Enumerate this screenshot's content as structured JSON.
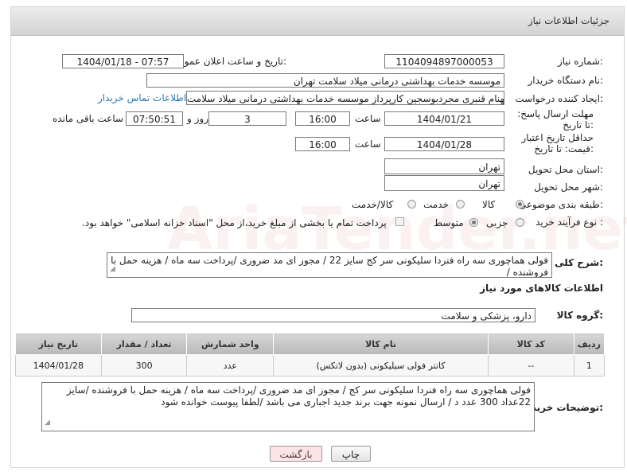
{
  "header": {
    "title": "جزئیات اطلاعات نیاز"
  },
  "fields": {
    "need_number_label": "شماره نیاز:",
    "need_number": "1104094897000053",
    "announce_label": "تاریخ و ساعت اعلان عمومی:",
    "announce_value": "1404/01/18 - 07:57",
    "buyer_org_label": "نام دستگاه خریدار:",
    "buyer_org": "موسسه خدمات بهداشتی درمانی میلاد سلامت تهران",
    "creator_label": "ایجاد کننده درخواست:",
    "creator": "بهنام قنبری مجردبوسجین کارپرداز موسسه خدمات بهداشتی درمانی میلاد سلامت",
    "contact_link": "اطلاعات تماس خریدار",
    "deadline_label": "مهلت ارسال پاسخ: تا تاریخ:",
    "deadline_date": "1404/01/21",
    "time_label": "ساعت",
    "deadline_time": "16:00",
    "days_value": "3",
    "days_label": "روز و",
    "remaining_time": "07:50:51",
    "remaining_label": "ساعت باقی مانده",
    "price_validity_label": "حداقل تاریخ اعتبار قیمت: تا تاریخ:",
    "price_validity_date": "1404/01/28",
    "price_validity_time": "16:00",
    "province_label": "استان محل تحویل:",
    "province": "تهران",
    "city_label": "شهر محل تحویل:",
    "city": "تهران",
    "category_label": "طبقه بندی موضوعی:",
    "category_options": [
      "کالا",
      "خدمت",
      "کالا/خدمت"
    ],
    "process_label": "نوع فرآیند خرید :",
    "process_options": [
      "جزیی",
      "متوسط"
    ],
    "payment_note": "پرداخت تمام یا بخشی از مبلغ خرید،از محل \"اسناد خزانه اسلامی\" خواهد بود.",
    "description_label": "شرح کلی نیاز:",
    "description": "فولی هماچوری  سه راه فنردا سلیکونی سر کج سایز 22  / مجوز ای مد ضروری /پرداخت سه ماه / هزینه حمل با فروشنده /",
    "goods_info_title": "اطلاعات کالاهای مورد نیاز",
    "goods_group_label": "گروه کالا:",
    "goods_group": "دارو، پزشکی و سلامت"
  },
  "table": {
    "headers": [
      "ردیف",
      "کد کالا",
      "نام کالا",
      "واحد شمارش",
      "تعداد / مقدار",
      "تاریخ نیاز"
    ],
    "rows": [
      {
        "row": "1",
        "code": "--",
        "name": "کاتتر فولی سیلیکونی (بدون لاتکس)",
        "unit": "عدد",
        "qty": "300",
        "date": "1404/01/28"
      }
    ]
  },
  "buyer_notes_label": "توضیحات خریدار:",
  "buyer_notes": "فولی هماچوری  سه راه فنردا سلیکونی سر کج  / مجوز ای مد ضروری /پرداخت سه ماه / هزینه حمل با فروشنده /سایز 22عداد 300 عدد د / ارسال نمونه جهت برند جدید اجباری می باشد /لطفا پیوست خوانده شود",
  "buttons": {
    "print": "چاپ",
    "back": "بازگشت"
  },
  "watermark": "AriaTender.net"
}
